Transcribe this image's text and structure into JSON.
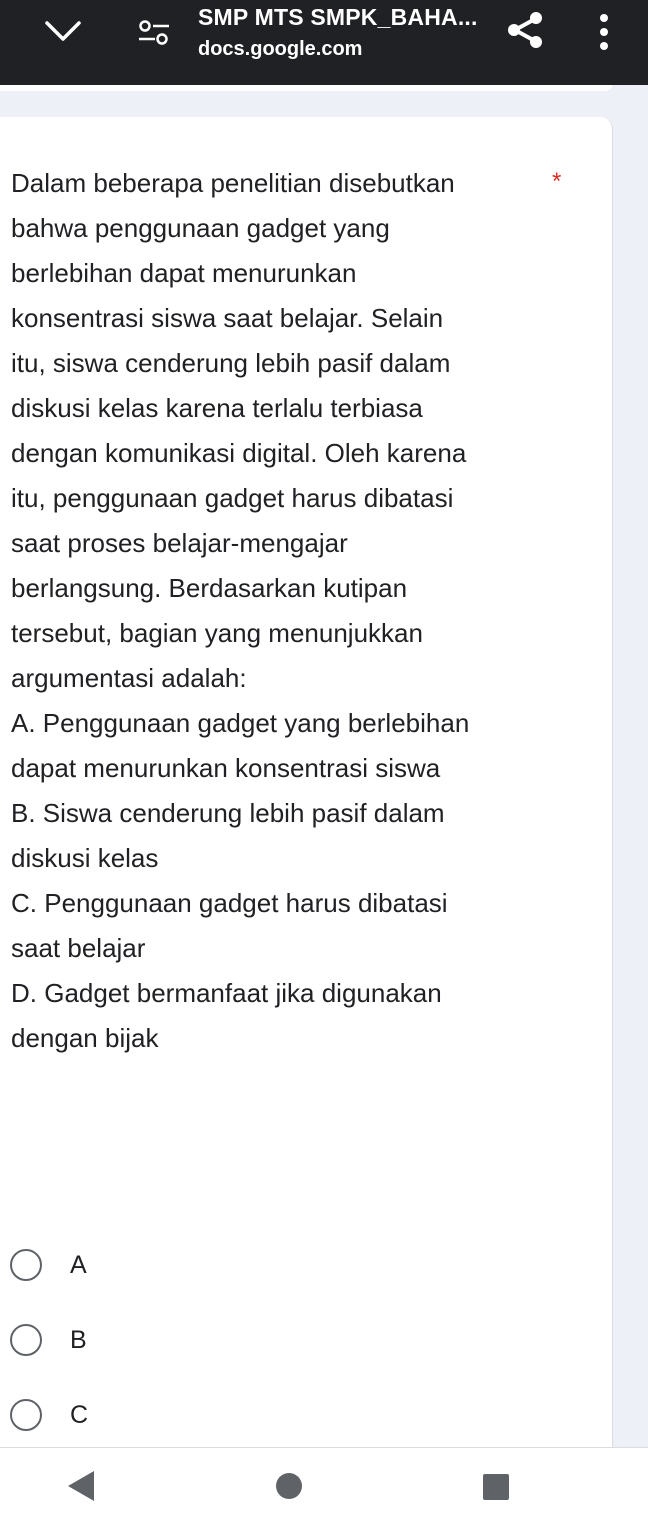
{
  "browser": {
    "title": "SMP MTS SMPK_BAHA...",
    "url": "docs.google.com",
    "icons": [
      "chevron-down-icon",
      "tune-icon",
      "share-icon",
      "more-vert-icon"
    ]
  },
  "question": {
    "text_lines": [
      "Dalam beberapa penelitian disebutkan",
      "bahwa penggunaan gadget yang",
      "berlebihan dapat menurunkan",
      "konsentrasi siswa saat belajar. Selain",
      "itu, siswa cenderung lebih pasif dalam",
      "diskusi kelas karena terlalu terbiasa",
      "dengan komunikasi digital. Oleh karena",
      "itu, penggunaan gadget harus dibatasi",
      "saat proses belajar-mengajar",
      "berlangsung. Berdasarkan kutipan",
      "tersebut, bagian yang menunjukkan",
      "argumentasi adalah:",
      "A. Penggunaan gadget yang berlebihan",
      "dapat menurunkan konsentrasi siswa",
      "B. Siswa cenderung lebih pasif dalam",
      "diskusi kelas",
      "C. Penggunaan gadget harus dibatasi",
      "saat belajar",
      "D. Gadget bermanfaat jika digunakan",
      "dengan bijak"
    ],
    "required_marker": "*"
  },
  "options": [
    {
      "label": "A",
      "selected": false
    },
    {
      "label": "B",
      "selected": false
    },
    {
      "label": "C",
      "selected": false
    }
  ],
  "colors": {
    "topbar": "#202124",
    "page_bg": "#eef0f8",
    "required": "#d93025",
    "radio_border": "#5f6368",
    "nav_icon": "#5f6368"
  }
}
